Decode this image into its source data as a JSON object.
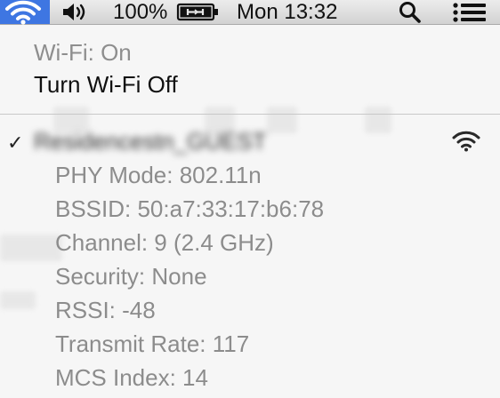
{
  "menubar": {
    "battery_percent": "100%",
    "datetime": "Mon 13:32",
    "icons": [
      "wifi-icon",
      "volume-icon",
      "battery-charging-icon",
      "spotlight-search-icon",
      "notification-center-icon"
    ]
  },
  "wifi_menu": {
    "status": "Wi-Fi: On",
    "toggle_label": "Turn Wi-Fi Off",
    "network": {
      "name": "Residencestn_GUEST",
      "selected": true,
      "icon": "wifi-signal-icon"
    },
    "details": [
      "PHY Mode: 802.11n",
      "BSSID: 50:a7:33:17:b6:78",
      "Channel: 9 (2.4 GHz)",
      "Security: None",
      "RSSI: -48",
      "Transmit Rate: 117",
      "MCS Index: 14"
    ]
  },
  "colors": {
    "menubar_highlight": "#3e76e2",
    "disabled_text": "#8c8c8c",
    "enabled_text": "#101010"
  }
}
